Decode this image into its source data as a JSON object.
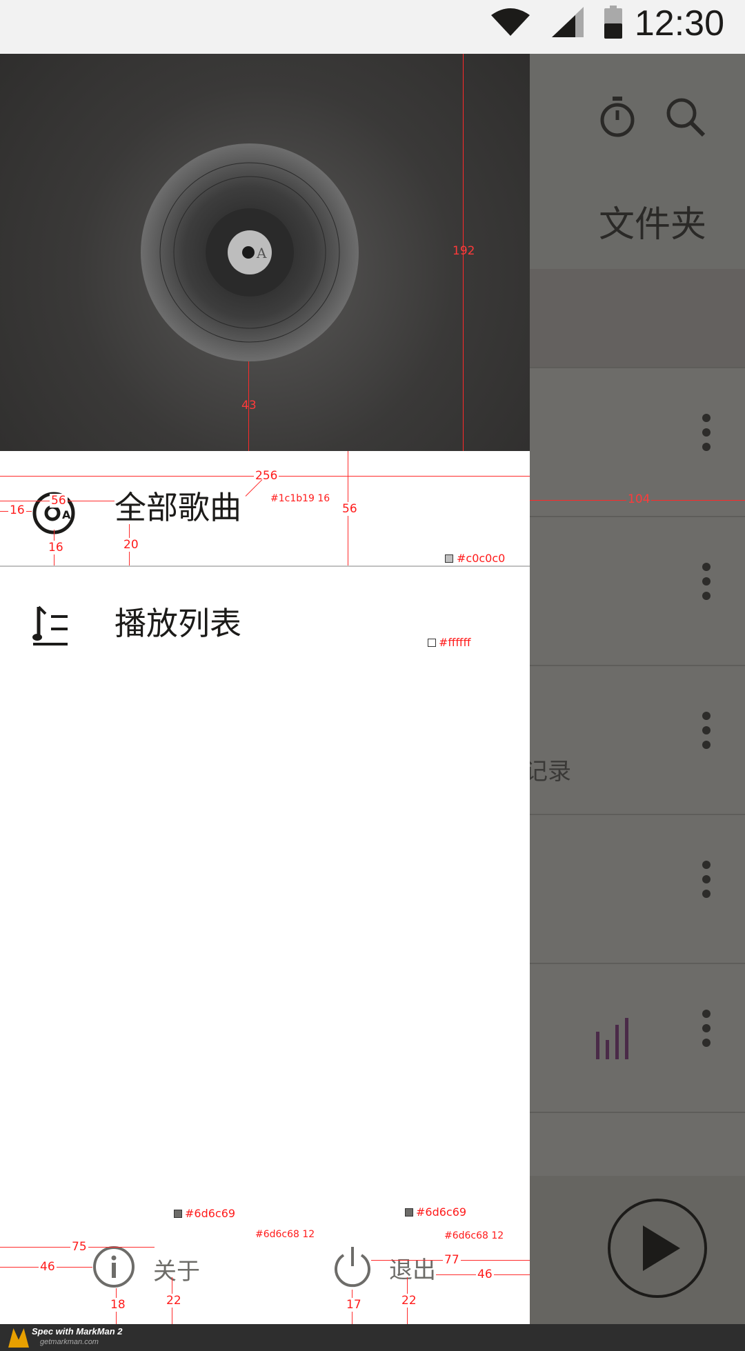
{
  "status_bar": {
    "time": "12:30"
  },
  "background_app": {
    "section_title": "文件夹",
    "partial_row_text": "记录",
    "icons": [
      "timer-icon",
      "search-icon",
      "more-vert-icon",
      "equalizer-icon",
      "play-icon"
    ]
  },
  "drawer": {
    "menu": [
      {
        "label": "全部歌曲",
        "icon": "album-icon"
      },
      {
        "label": "播放列表",
        "icon": "playlist-icon"
      }
    ],
    "bottom": {
      "about_label": "关于",
      "exit_label": "退出"
    }
  },
  "spec": {
    "header_height": "192",
    "disc_offset": "43",
    "drawer_width": "256",
    "item_icon_width": "56",
    "item_left_pad": "16",
    "item_icon_bottom": "16",
    "item_text_bottom": "20",
    "item_height": "56",
    "text_color_label": "#1c1b19 16",
    "divider_color": "#c0c0c0",
    "bg_color": "#ffffff",
    "scrim_width": "104",
    "about_icon_color": "#6d6c69",
    "about_text_color": "#6d6c68 12",
    "about_left_75": "75",
    "about_left_46": "46",
    "about_icon_bottom": "18",
    "about_text_bottom": "22",
    "exit_icon_color": "#6d6c69",
    "exit_text_color": "#6d6c68 12",
    "exit_right_77": "77",
    "exit_right_46": "46",
    "exit_icon_bottom": "17",
    "exit_text_bottom": "22"
  },
  "footer": {
    "brand": "Spec with MarkMan 2",
    "url": "getmarkman.com"
  }
}
